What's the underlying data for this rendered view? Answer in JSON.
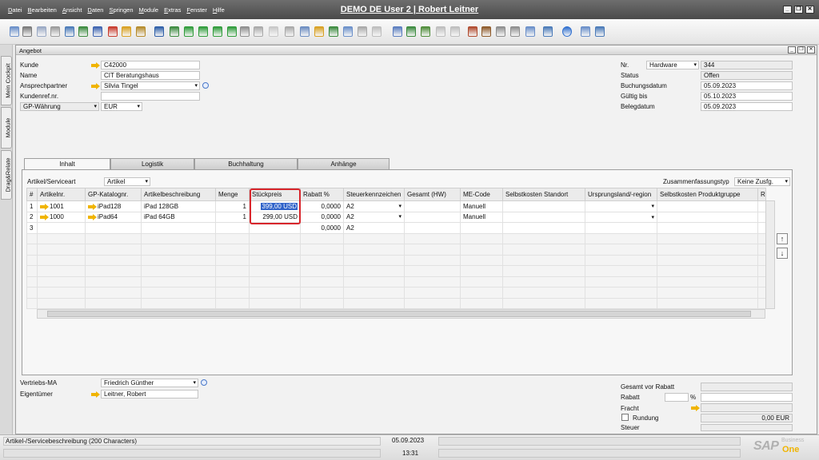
{
  "menu": [
    "Datei",
    "Bearbeiten",
    "Ansicht",
    "Daten",
    "Springen",
    "Module",
    "Extras",
    "Fenster",
    "Hilfe"
  ],
  "app_title": "DEMO DE User 2 | Robert Leitner",
  "side_tabs": [
    "Mein Cockpit",
    "Module",
    "Drag&Relate"
  ],
  "document": {
    "title": "Angebot",
    "header_left": {
      "kunde_label": "Kunde",
      "kunde_value": "C42000",
      "name_label": "Name",
      "name_value": "CIT Beratungshaus",
      "ansprechpartner_label": "Ansprechpartner",
      "ansprechpartner_value": "Silvia Tingel",
      "kundenref_label": "Kundenref.nr.",
      "kundenref_value": "",
      "gp_waehrung_label": "GP-Währung",
      "gp_waehrung_value": "EUR"
    },
    "header_right": {
      "nr_label": "Nr.",
      "nr_series": "Hardware",
      "nr_value": "344",
      "status_label": "Status",
      "status_value": "Offen",
      "buchungsdatum_label": "Buchungsdatum",
      "buchungsdatum_value": "05.09.2023",
      "gueltig_label": "Gültig bis",
      "gueltig_value": "05.10.2023",
      "belegdatum_label": "Belegdatum",
      "belegdatum_value": "05.09.2023"
    },
    "tabs": [
      "Inhalt",
      "Logistik",
      "Buchhaltung",
      "Anhänge"
    ],
    "content": {
      "artikel_type_label": "Artikel/Serviceart",
      "artikel_type_value": "Artikel",
      "summary_label": "Zusammenfassungstyp",
      "summary_value": "Keine Zusfg.",
      "columns": [
        "#",
        "Artikelnr.",
        "GP-Katalognr.",
        "Artikelbeschreibung",
        "Menge",
        "Stückpreis",
        "Rabatt %",
        "Steuerkennzeichen",
        "Gesamt (HW)",
        "ME-Code",
        "Selbstkosten Standort",
        "Ursprungsland/-region",
        "Selbstkosten Produktgruppe",
        "R"
      ],
      "rows": [
        {
          "no": "1",
          "artikel": "1001",
          "katalog": "iPad128",
          "beschreibung": "iPad 128GB",
          "menge": "1",
          "preis": "399,00 USD",
          "rabatt": "0,0000",
          "steuer": "A2",
          "gesamt": "",
          "me": "Manuell"
        },
        {
          "no": "2",
          "artikel": "1000",
          "katalog": "iPad64",
          "beschreibung": "iPad 64GB",
          "menge": "1",
          "preis": "299,00 USD",
          "rabatt": "0,0000",
          "steuer": "A2",
          "gesamt": "",
          "me": "Manuell"
        },
        {
          "no": "3",
          "artikel": "",
          "katalog": "",
          "beschreibung": "",
          "menge": "",
          "preis": "",
          "rabatt": "0,0000",
          "steuer": "A2",
          "gesamt": "",
          "me": ""
        }
      ]
    },
    "footer_left": {
      "vertriebs_label": "Vertriebs-MA",
      "vertriebs_value": "Friedrich Günther",
      "eigentuemer_label": "Eigentümer",
      "eigentuemer_value": "Leitner, Robert"
    },
    "footer_right": {
      "gesamt_label": "Gesamt vor Rabatt",
      "gesamt_value": "",
      "rabatt_label": "Rabatt",
      "rabatt_pct": "%",
      "fracht_label": "Fracht",
      "rundung_label": "Rundung",
      "rundung_value": "0,00 EUR",
      "steuer_label": "Steuer"
    }
  },
  "status_bar": {
    "message": "Artikel-/Servicebeschreibung (200 Characters)",
    "date": "05.09.2023",
    "time": "13:31",
    "logo_text": "SAP",
    "logo_business": "Business",
    "logo_one": "One"
  },
  "colors": {
    "highlight": "#d8262c",
    "selection": "#2f62c9",
    "arrow": "#f0b400"
  }
}
